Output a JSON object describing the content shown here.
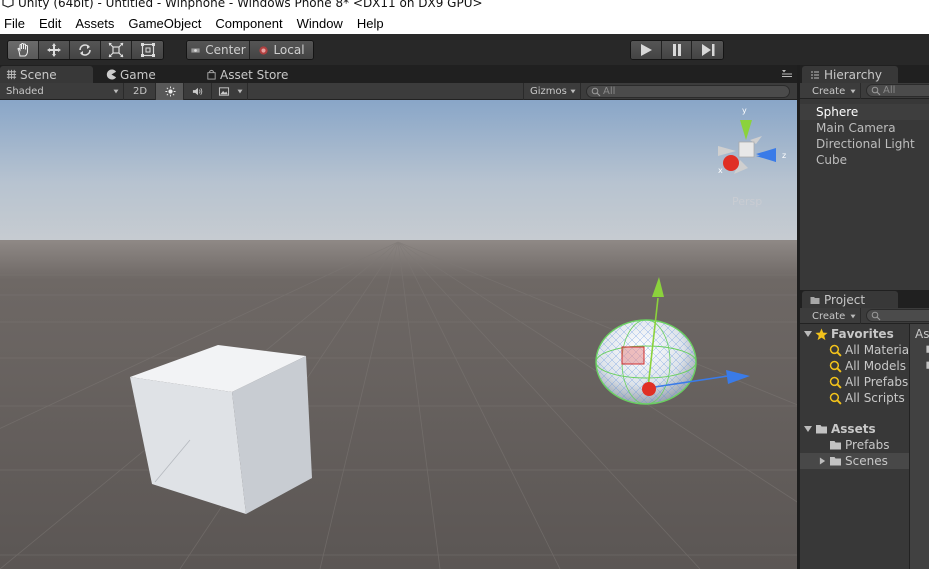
{
  "window": {
    "title": "Unity (64bit) - Untitled - Winphone - Windows Phone 8* <DX11 on DX9 GPU>"
  },
  "menu": [
    "File",
    "Edit",
    "Assets",
    "GameObject",
    "Component",
    "Window",
    "Help"
  ],
  "toolbar": {
    "pivot_label": "Center",
    "space_label": "Local"
  },
  "scene_tabs": {
    "scene": "Scene",
    "game": "Game",
    "asset_store": "Asset Store"
  },
  "scene_toolbar": {
    "draw_mode": "Shaded",
    "mode_2d": "2D",
    "gizmos": "Gizmos",
    "search_placeholder": "All"
  },
  "viewport": {
    "persp_label": "Persp",
    "axis_labels": {
      "y": "y",
      "z": "z",
      "x": "x"
    }
  },
  "hierarchy": {
    "tab": "Hierarchy",
    "create": "Create",
    "search_placeholder": "All",
    "items": [
      "Sphere",
      "Main Camera",
      "Directional Light",
      "Cube"
    ],
    "selected": "Sphere"
  },
  "project": {
    "tab": "Project",
    "create": "Create",
    "favorites_label": "Favorites",
    "favorites": [
      "All Material",
      "All Models",
      "All Prefabs",
      "All Scripts"
    ],
    "assets_label": "Assets",
    "folders": [
      "Prefabs",
      "Scenes"
    ],
    "selected_folder": "Scenes",
    "right_header": "As"
  },
  "colors": {
    "toolbar_bg": "#282828",
    "panel_bg": "#383838",
    "axis_x": "#e03a2a",
    "axis_y": "#8bd23c",
    "axis_z": "#3a7be8",
    "favorite_star": "#f2c21b"
  }
}
